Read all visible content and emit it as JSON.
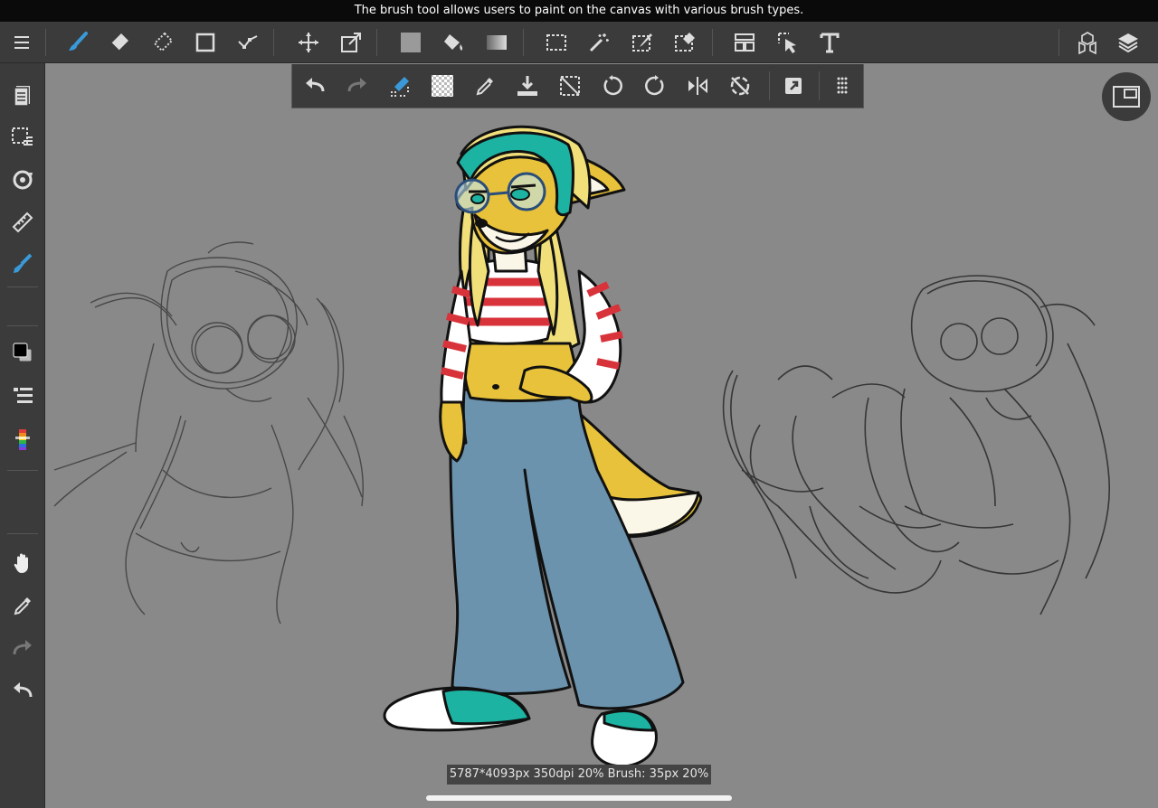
{
  "caption": "The brush tool allows users to paint on the canvas with various brush types.",
  "status": "5787*4093px 350dpi 20% Brush: 35px 20%",
  "colors": {
    "accent": "#3a9ad9",
    "panel": "#3b3b3b",
    "canvas": "#898989",
    "skin": "#e8c23a",
    "hair": "#f1e07a",
    "teal": "#1db3a2",
    "jeans": "#6b93ad",
    "stripe_red": "#d8333a"
  },
  "toolbar": {
    "items": [
      "menu-icon",
      "brush-icon",
      "eraser-icon",
      "blur-icon",
      "rectangle-icon",
      "vector-icon",
      "move-icon",
      "transform-icon",
      "fill-color-icon",
      "bucket-icon",
      "gradient-icon",
      "select-rect-icon",
      "magic-wand-icon",
      "select-pen-icon",
      "select-eraser-icon",
      "frame-icon",
      "operation-icon",
      "text-icon",
      "3d-material-icon",
      "layers-icon"
    ]
  },
  "sidebar": {
    "items": [
      "pages-icon",
      "selection-layer-icon",
      "snap-icon",
      "ruler-icon",
      "pen-icon",
      "color-swatch-icon",
      "brush-list-icon",
      "color-picker-icon",
      "hand-icon",
      "eyedropper-icon",
      "redo-icon",
      "undo-icon"
    ]
  },
  "floatbar": {
    "items": [
      "undo-icon",
      "redo-icon",
      "ruler-snap-icon",
      "transparent-icon",
      "eyedropper-icon",
      "save-icon",
      "deselect-icon",
      "rotate-left-icon",
      "rotate-right-icon",
      "flip-icon",
      "reset-rotation-icon",
      "export-icon",
      "grid-handle-icon"
    ]
  }
}
